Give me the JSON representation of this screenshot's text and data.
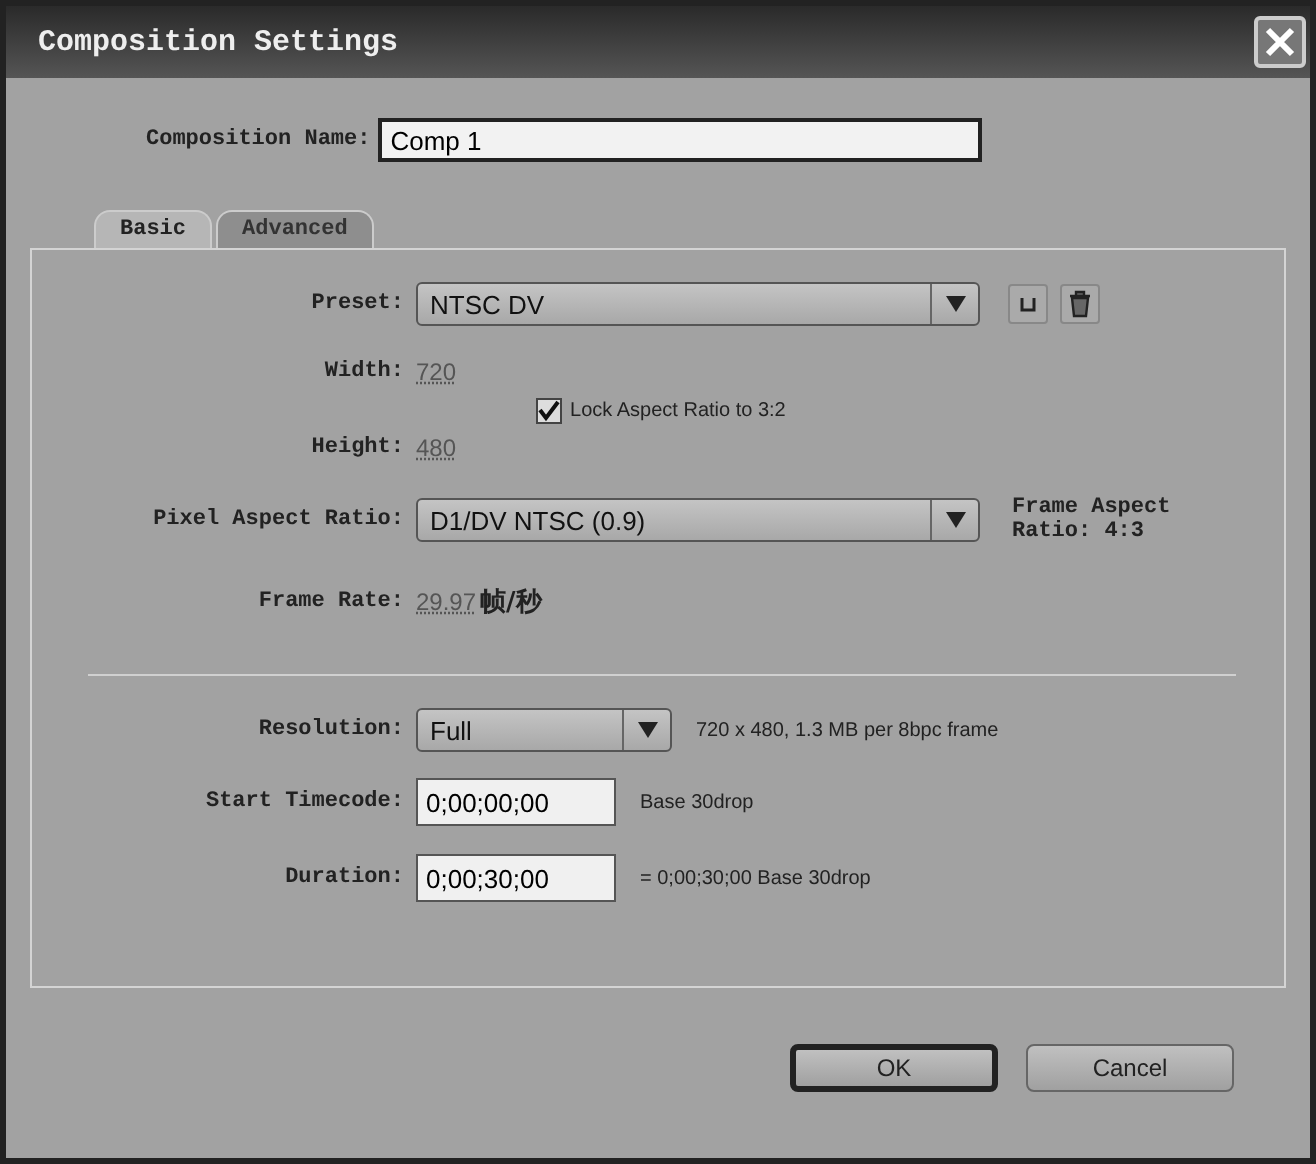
{
  "window": {
    "title": "Composition Settings"
  },
  "composition_name": {
    "label": "Composition Name:",
    "value": "Comp 1"
  },
  "tabs": [
    {
      "label": "Basic",
      "selected": true
    },
    {
      "label": "Advanced",
      "selected": false
    }
  ],
  "preset": {
    "label": "Preset:",
    "value": "NTSC DV"
  },
  "width": {
    "label": "Width:",
    "value": "720"
  },
  "height": {
    "label": "Height:",
    "value": "480"
  },
  "lock_aspect": {
    "label": "Lock Aspect Ratio to 3:2",
    "checked": true
  },
  "pixel_aspect_ratio": {
    "label": "Pixel Aspect Ratio:",
    "value": "D1/DV NTSC (0.9)",
    "note": "Frame Aspect Ratio: 4:3"
  },
  "frame_rate": {
    "label": "Frame Rate:",
    "value": "29.97",
    "unit": "帧/秒"
  },
  "resolution": {
    "label": "Resolution:",
    "value": "Full",
    "note": "720 x 480, 1.3 MB per 8bpc frame"
  },
  "start_timecode": {
    "label": "Start Timecode:",
    "value": "0;00;00;00",
    "note": "Base 30drop"
  },
  "duration": {
    "label": "Duration:",
    "value": "0;00;30;00",
    "note": "= 0;00;30;00 Base 30drop"
  },
  "buttons": [
    {
      "label": "OK",
      "default": true
    },
    {
      "label": "Cancel",
      "default": false
    }
  ]
}
